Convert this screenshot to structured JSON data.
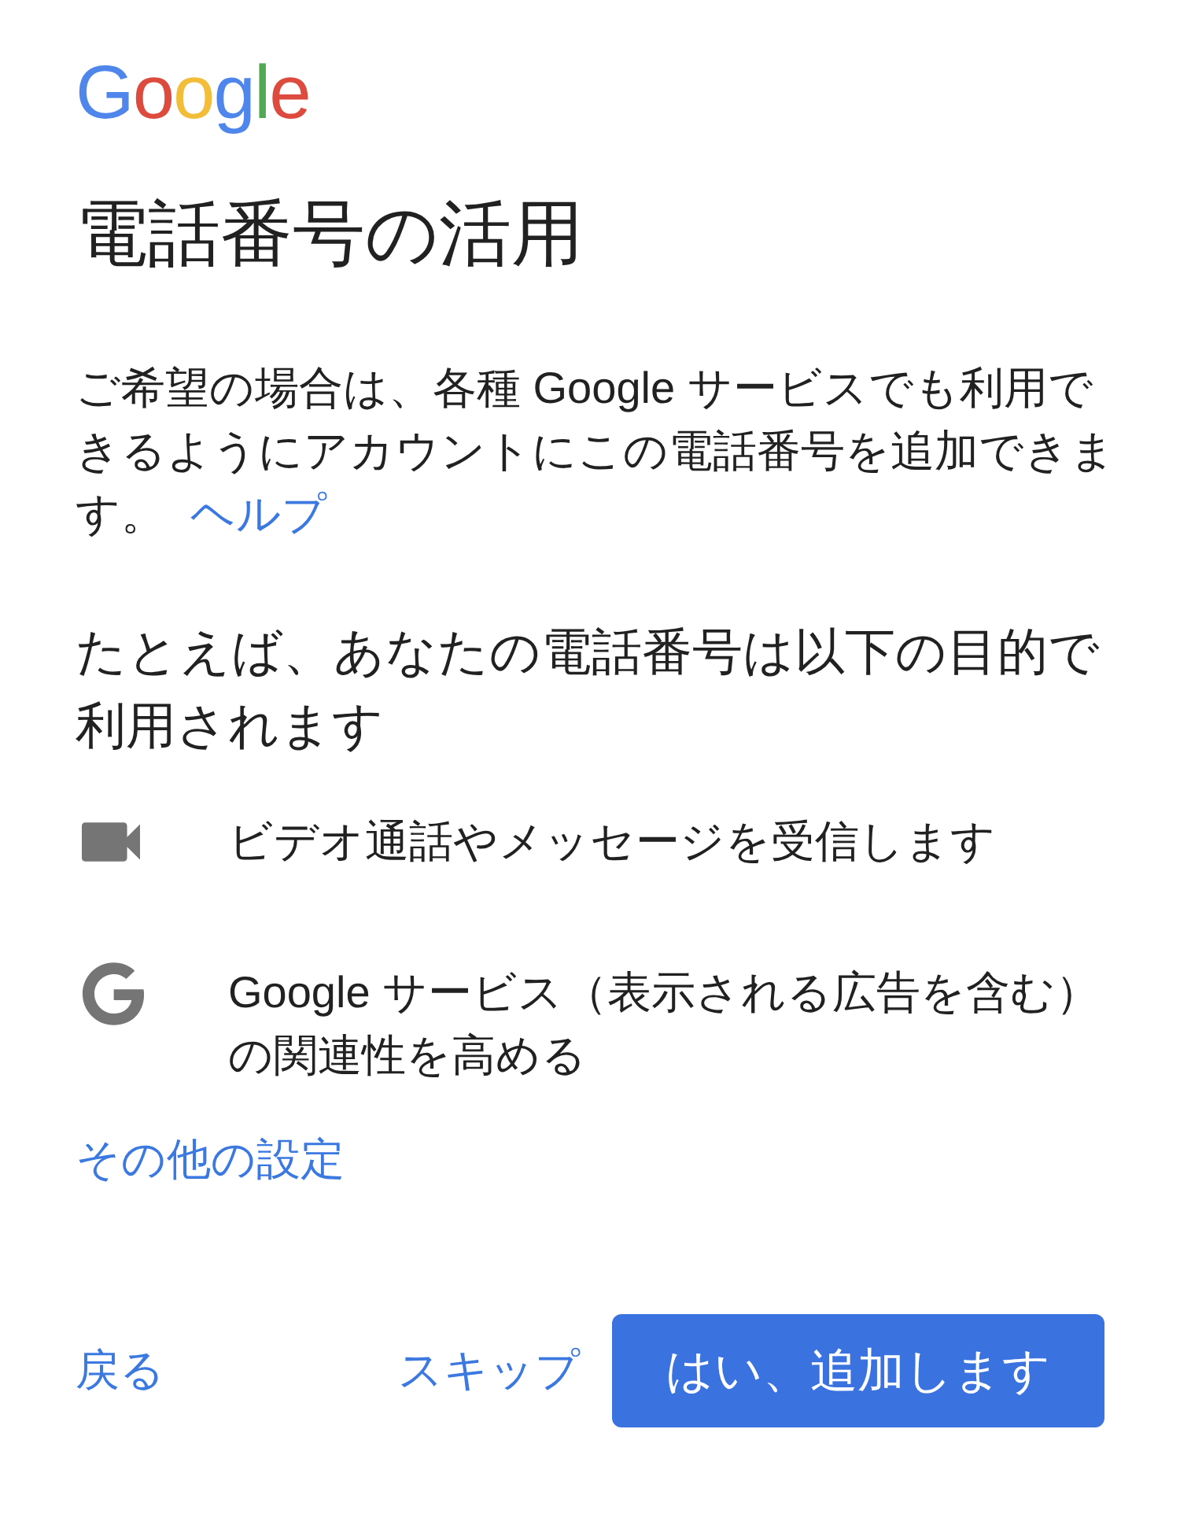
{
  "logo": {
    "text": "Google"
  },
  "title": "電話番号の活用",
  "intro": {
    "text": "ご希望の場合は、各種 Google サービスでも利用できるようにアカウントにこの電話番号を追加できます。",
    "link": "ヘルプ"
  },
  "subheading": "たとえば、あなたの電話番号は以下の目的で利用されます",
  "uses": [
    {
      "kind": "video",
      "text": "ビデオ通話やメッセージを受信します"
    },
    {
      "kind": "google",
      "text": "Google サービス（表示される広告を含む）の関連性を高める"
    }
  ],
  "more_link": "その他の設定",
  "buttons": [
    {
      "kind": "text",
      "label": "戻る"
    },
    {
      "kind": "text",
      "label": "スキップ"
    },
    {
      "kind": "filled",
      "label": "はい、追加します"
    }
  ]
}
